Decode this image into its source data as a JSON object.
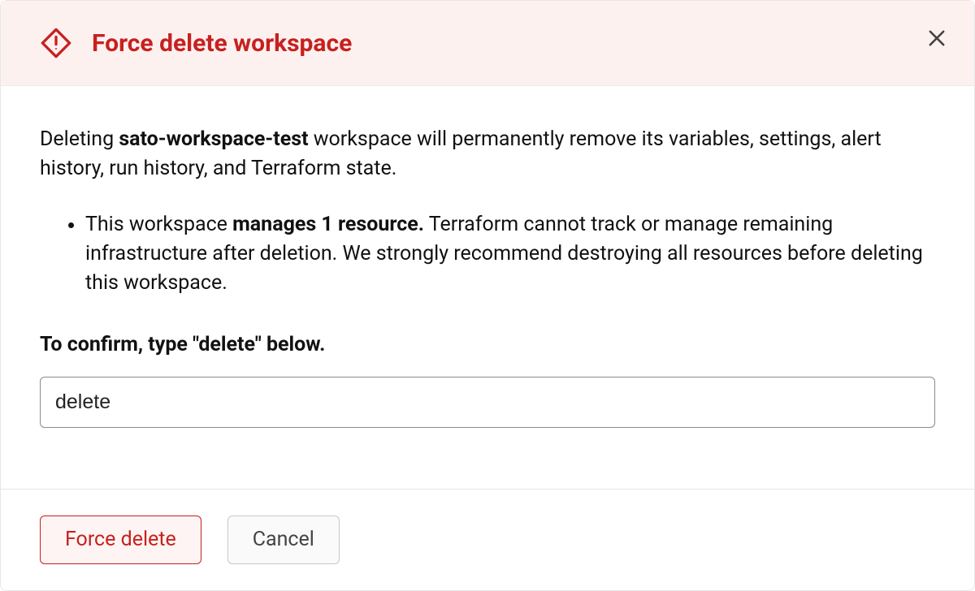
{
  "header": {
    "title": "Force delete workspace"
  },
  "body": {
    "intro_prefix": "Deleting ",
    "workspace_name": "sato-workspace-test",
    "intro_suffix": " workspace will permanently remove its variables, settings, alert history, run history, and Terraform state.",
    "bullet_strong": "manages 1 resource.",
    "bullet_prefix": "This workspace ",
    "bullet_suffix": " Terraform cannot track or manage remaining infrastructure after deletion. We strongly recommend destroying all resources before deleting this workspace.",
    "confirm_label": "To confirm, type \"delete\" below.",
    "input_value": "delete"
  },
  "footer": {
    "primary_label": "Force delete",
    "secondary_label": "Cancel"
  }
}
